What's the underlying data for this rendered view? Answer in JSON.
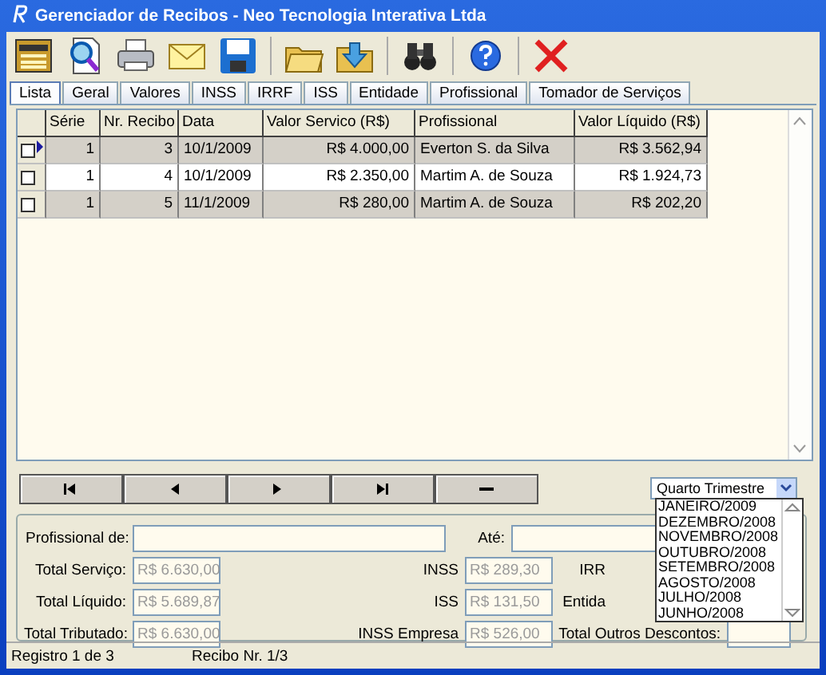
{
  "window": {
    "title": "Gerenciador de Recibos - Neo Tecnologia Interativa Ltda"
  },
  "toolbar": [
    [
      {
        "kind": "grid"
      },
      {
        "kind": "preview"
      },
      {
        "kind": "print"
      },
      {
        "kind": "mail"
      },
      {
        "kind": "save"
      }
    ],
    [
      {
        "kind": "open"
      },
      {
        "kind": "import"
      }
    ],
    [
      {
        "kind": "find"
      }
    ],
    [
      {
        "kind": "help"
      }
    ],
    [
      {
        "kind": "close"
      }
    ]
  ],
  "tabs": [
    {
      "label": "Lista",
      "selected": true
    },
    {
      "label": "Geral",
      "selected": false
    },
    {
      "label": "Valores",
      "selected": false
    },
    {
      "label": "INSS",
      "selected": false
    },
    {
      "label": "IRRF",
      "selected": false
    },
    {
      "label": "ISS",
      "selected": false
    },
    {
      "label": "Entidade",
      "selected": false
    },
    {
      "label": "Profissional",
      "selected": false
    },
    {
      "label": "Tomador de Serviços",
      "selected": false
    }
  ],
  "table": {
    "columns": [
      "Série",
      "Nr. Recibo",
      "Data",
      "Valor Servico (R$)",
      "Profissional",
      "Valor Líquido (R$)"
    ],
    "rows": [
      {
        "current": true,
        "checked": false,
        "cells": [
          "1",
          "3",
          "10/1/2009",
          "R$ 4.000,00",
          "Everton S. da Silva",
          "R$ 3.562,94"
        ]
      },
      {
        "current": false,
        "checked": false,
        "cells": [
          "1",
          "4",
          "10/1/2009",
          "R$ 2.350,00",
          "Martim A. de Souza",
          "R$ 1.924,73"
        ]
      },
      {
        "current": false,
        "checked": false,
        "cells": [
          "1",
          "5",
          "11/1/2009",
          "R$ 280,00",
          "Martim A. de Souza",
          "R$ 202,20"
        ]
      }
    ]
  },
  "navigator": [
    {
      "kind": "first"
    },
    {
      "kind": "prior"
    },
    {
      "kind": "next"
    },
    {
      "kind": "last"
    },
    {
      "kind": "delete"
    }
  ],
  "period": {
    "value": "Quarto Trimestre",
    "options": [
      "JANEIRO/2009",
      "DEZEMBRO/2008",
      "NOVEMBRO/2008",
      "OUTUBRO/2008",
      "SETEMBRO/2008",
      "AGOSTO/2008",
      "JULHO/2008",
      "JUNHO/2008"
    ]
  },
  "filter": {
    "from_label": "Profissional de:",
    "to_label": "Até:",
    "totals": [
      [
        {
          "kind": "value",
          "label": "Total Serviço:",
          "value": "R$ 6.630,00",
          "disabled": true
        },
        {
          "kind": "value",
          "label": "INSS",
          "value": "R$ 289,30",
          "disabled": true
        },
        {
          "kind": "label",
          "label": "IRR"
        }
      ],
      [
        {
          "kind": "value",
          "label": "Total Líquido:",
          "value": "R$ 5.689,87",
          "disabled": true
        },
        {
          "kind": "value",
          "label": "ISS",
          "value": "R$ 131,50",
          "disabled": true
        },
        {
          "kind": "label",
          "label": "Entida"
        }
      ],
      [
        {
          "kind": "value",
          "label": "Total Tributado:",
          "value": "R$ 6.630,00",
          "disabled": true
        },
        {
          "kind": "value",
          "label": "INSS Empresa",
          "value": "R$ 526,00",
          "disabled": true
        },
        {
          "kind": "empty",
          "label": "Total Outros Descontos:"
        }
      ]
    ]
  },
  "status_bar": [
    "Registro 1 de 3",
    "Recibo Nr. 1/3"
  ]
}
